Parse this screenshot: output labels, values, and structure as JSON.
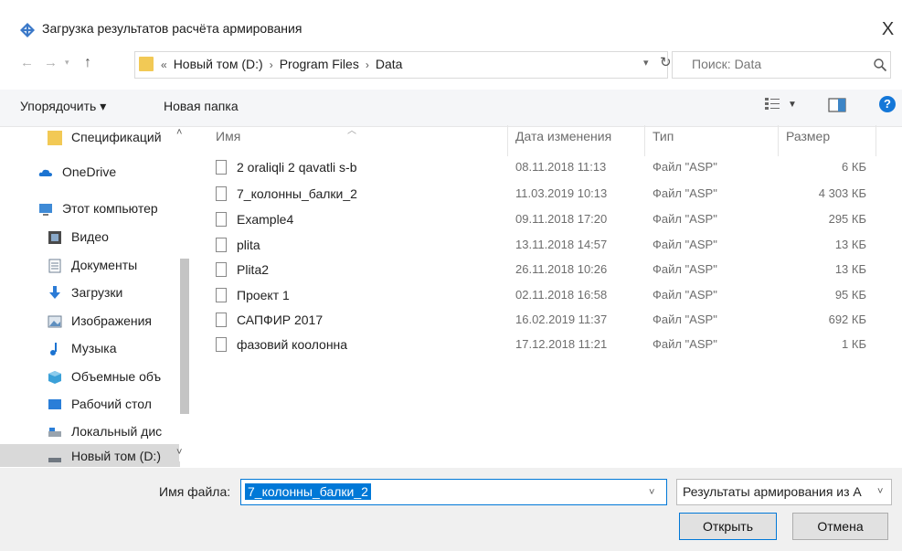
{
  "window": {
    "title": "Загрузка результатов расчёта армирования",
    "close_label": "X"
  },
  "address": {
    "crumbs": [
      "Новый том (D:)",
      "Program Files",
      "Data"
    ],
    "prefix": "«",
    "sep": "›"
  },
  "search": {
    "placeholder": "Поиск: Data"
  },
  "toolbar": {
    "organize_label": "Упорядочить ▾",
    "new_folder_label": "Новая папка",
    "help_label": "?"
  },
  "nav": {
    "items": [
      {
        "label": "Спецификаций",
        "icon": "folder-icon"
      },
      {
        "label": "OneDrive",
        "icon": "cloud-icon"
      },
      {
        "label": "Этот компьютер",
        "icon": "computer-icon"
      },
      {
        "label": "Видео",
        "icon": "video-icon"
      },
      {
        "label": "Документы",
        "icon": "documents-icon"
      },
      {
        "label": "Загрузки",
        "icon": "download-icon"
      },
      {
        "label": "Изображения",
        "icon": "pictures-icon"
      },
      {
        "label": "Музыка",
        "icon": "music-icon"
      },
      {
        "label": "Объемные объ",
        "icon": "3d-objects-icon"
      },
      {
        "label": "Рабочий стол",
        "icon": "desktop-icon"
      },
      {
        "label": "Локальный дис",
        "icon": "drive-icon"
      },
      {
        "label": "Новый том (D:)",
        "icon": "drive-icon"
      }
    ]
  },
  "columns": {
    "name": "Имя",
    "date": "Дата изменения",
    "type": "Тип",
    "size": "Размер"
  },
  "files": [
    {
      "name": "2 oraliqli 2 qavatli s-b",
      "date": "08.11.2018 11:13",
      "type": "Файл \"ASP\"",
      "size": "6 КБ"
    },
    {
      "name": "7_колонны_балки_2",
      "date": "11.03.2019 10:13",
      "type": "Файл \"ASP\"",
      "size": "4 303 КБ"
    },
    {
      "name": "Example4",
      "date": "09.11.2018 17:20",
      "type": "Файл \"ASP\"",
      "size": "295 КБ"
    },
    {
      "name": "plita",
      "date": "13.11.2018 14:57",
      "type": "Файл \"ASP\"",
      "size": "13 КБ"
    },
    {
      "name": "Plita2",
      "date": "26.11.2018 10:26",
      "type": "Файл \"ASP\"",
      "size": "13 КБ"
    },
    {
      "name": "Проект 1",
      "date": "02.11.2018 16:58",
      "type": "Файл \"ASP\"",
      "size": "95 КБ"
    },
    {
      "name": "САПФИР 2017",
      "date": "16.02.2019 11:37",
      "type": "Файл \"ASP\"",
      "size": "692 КБ"
    },
    {
      "name": "фазовий коолонна",
      "date": "17.12.2018 11:21",
      "type": "Файл \"ASP\"",
      "size": "1 КБ"
    }
  ],
  "footer": {
    "filename_label": "Имя файла:",
    "filename_value": "7_колонны_балки_2",
    "filetype_value": "Результаты армирования из А",
    "open_label": "Открыть",
    "cancel_label": "Отмена"
  },
  "colors": {
    "accent": "#0078d7",
    "folder": "#f2c955",
    "help": "#1477d8"
  }
}
